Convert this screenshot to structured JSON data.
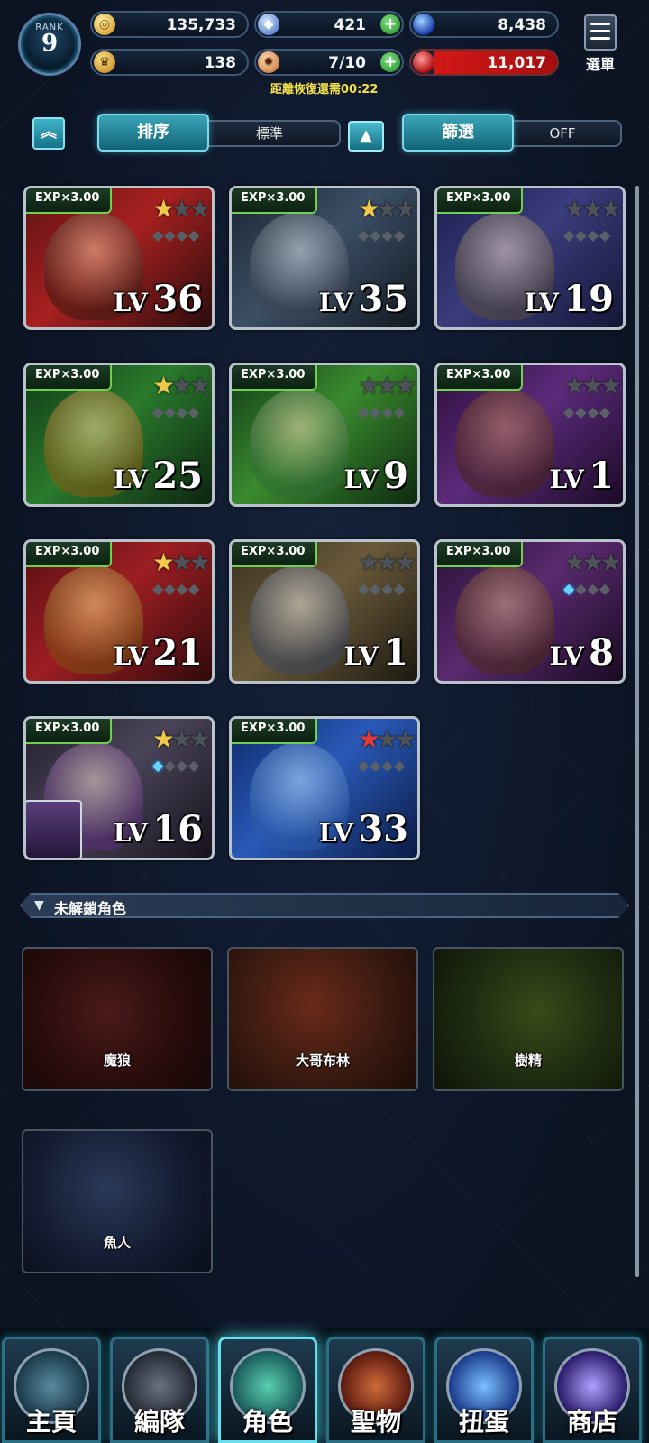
{
  "header": {
    "rank_label": "RANK",
    "rank_value": "9",
    "gold": "135,733",
    "crystals": "421",
    "blue_orbs": "8,438",
    "trophies": "138",
    "stamina": "7/10",
    "red_orbs": "11,017",
    "recover_text": "距離恢復還需00:22",
    "menu_label": "選單"
  },
  "toolbar": {
    "sort_label": "排序",
    "sort_value": "標準",
    "filter_label": "篩選",
    "filter_value": "OFF"
  },
  "characters": [
    {
      "exp": "EXP×3.00",
      "lv_prefix": "LV",
      "level": "36"
    },
    {
      "exp": "EXP×3.00",
      "lv_prefix": "LV",
      "level": "35"
    },
    {
      "exp": "EXP×3.00",
      "lv_prefix": "LV",
      "level": "19"
    },
    {
      "exp": "EXP×3.00",
      "lv_prefix": "LV",
      "level": "25"
    },
    {
      "exp": "EXP×3.00",
      "lv_prefix": "LV",
      "level": "9"
    },
    {
      "exp": "EXP×3.00",
      "lv_prefix": "LV",
      "level": "1"
    },
    {
      "exp": "EXP×3.00",
      "lv_prefix": "LV",
      "level": "21"
    },
    {
      "exp": "EXP×3.00",
      "lv_prefix": "LV",
      "level": "1"
    },
    {
      "exp": "EXP×3.00",
      "lv_prefix": "LV",
      "level": "8"
    },
    {
      "exp": "EXP×3.00",
      "lv_prefix": "LV",
      "level": "16"
    },
    {
      "exp": "EXP×3.00",
      "lv_prefix": "LV",
      "level": "33"
    }
  ],
  "locked_section": {
    "title": "未解鎖角色",
    "items": [
      "魔狼",
      "大哥布林",
      "樹精",
      "魚人"
    ]
  },
  "nav": {
    "items": [
      "主頁",
      "編隊",
      "角色",
      "聖物",
      "扭蛋",
      "商店"
    ],
    "active": "角色"
  },
  "colors": {
    "accent": "#3aa5b8",
    "exp_border": "#6fd14f",
    "star": "#f0c94a",
    "red_star": "#e23b3b",
    "recover_text": "#f2e04a"
  }
}
